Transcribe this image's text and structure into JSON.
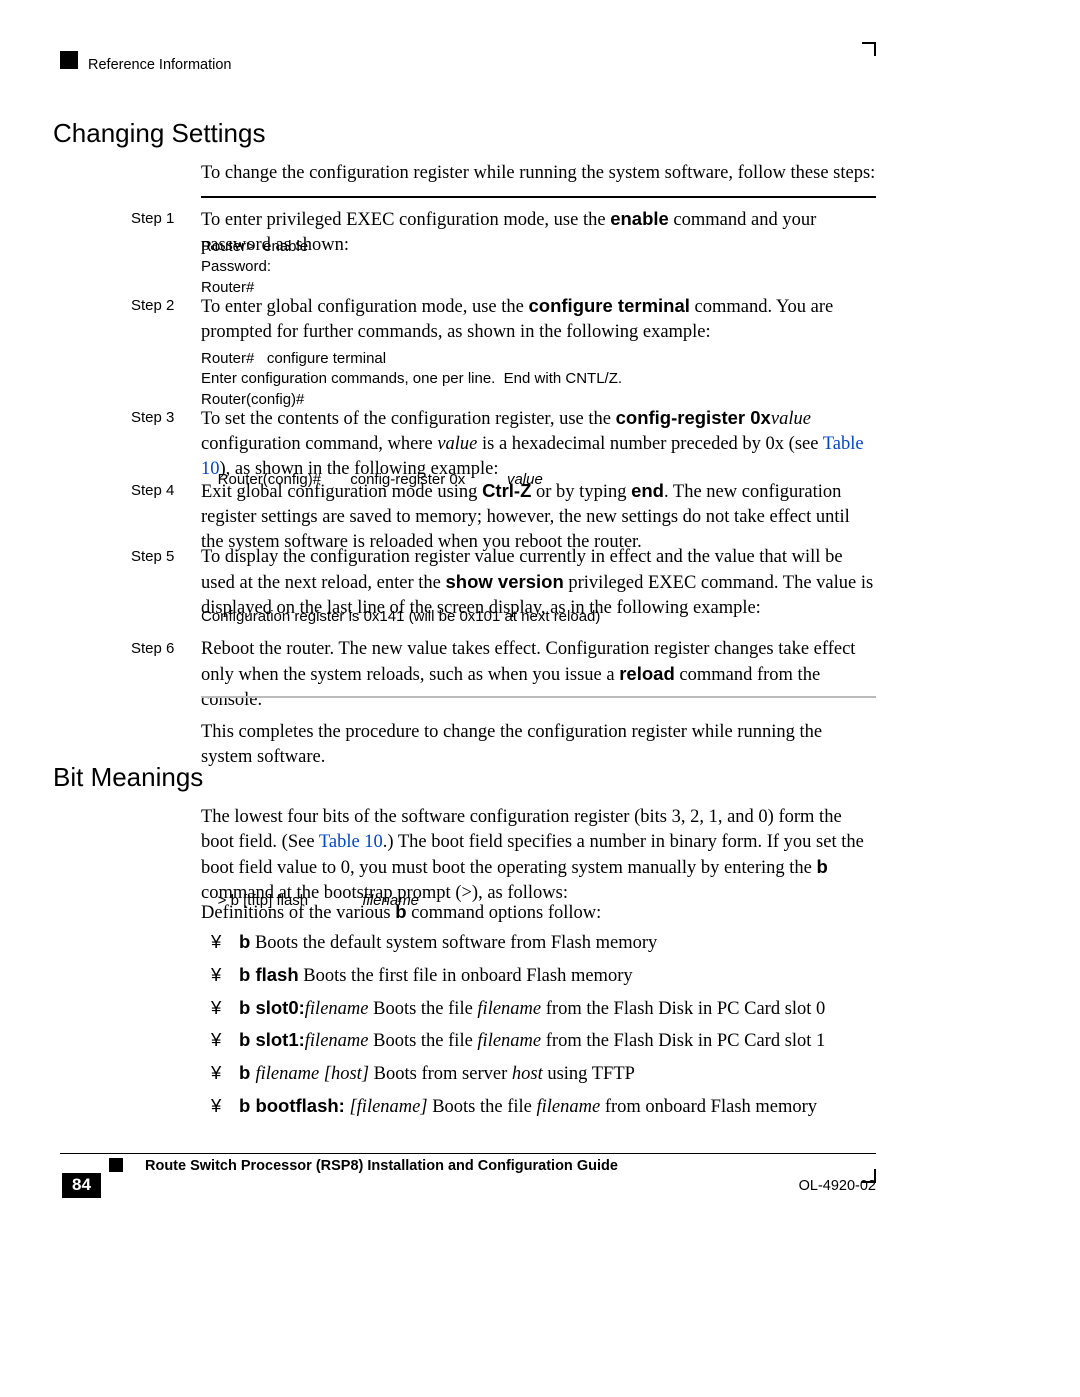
{
  "header": {
    "ref": "Reference Information"
  },
  "sections": {
    "changing_settings": {
      "title": "Changing Settings",
      "intro": "To change the configuration register while running the system software, follow these steps:",
      "outro": "This completes the procedure to change the configuration register while running the system software."
    },
    "bit_meanings": {
      "title": "Bit Meanings",
      "para1a": "The lowest four bits of the software configuration register (bits 3, 2, 1, and 0) form the boot field. (See",
      "para1_link": "Table 10",
      "para1b": ".) The boot field specifies a number in binary form. If you set the boot field value to 0, you must boot the operating system manually by entering the ",
      "b_cmd": "b",
      "para1c": " command at the bootstrap prompt (>), as follows:",
      "code_line_a": "> b [tftp] flash ",
      "code_line_b": "filename",
      "def_intro_a": "Definitions of the various ",
      "def_intro_b": "b",
      "def_intro_c": " command options follow:"
    }
  },
  "steps": {
    "s1": {
      "label": "Step 1",
      "text_a": "To enter privileged EXEC configuration mode, use the ",
      "cmd": "enable",
      "text_b": " command and your password as shown:",
      "code": "Router>  enable\nPassword:\nRouter#"
    },
    "s2": {
      "label": "Step 2",
      "text_a": "To enter global configuration mode, use the ",
      "cmd": "configure terminal",
      "text_b": " command. You are prompted for further commands, as shown in the following example:",
      "code": "Router#   configure terminal\nEnter configuration commands, one per line.  End with CNTL/Z.\nRouter(config)#"
    },
    "s3": {
      "label": "Step 3",
      "text_a": "To set the contents of the configuration register, use the ",
      "cmd": "config-register 0x",
      "val": "value",
      "text_b": " configuration command, where ",
      "val2": "value",
      "text_c": " is a hexadecimal number preceded by 0x (see ",
      "link": "Table 10",
      "text_d": "), as shown in the following example:",
      "code_a": "Router(config)#       config-register 0x",
      "code_b": "value"
    },
    "s4": {
      "label": "Step 4",
      "text_a": "Exit global configuration mode using ",
      "cmd1": "Ctrl-Z",
      "text_b": " or by typing ",
      "cmd2": "end",
      "text_c": ". The new configuration register settings are saved to memory; however, the new settings do not take effect until the system software is reloaded when you reboot the router."
    },
    "s5": {
      "label": "Step 5",
      "text_a": "To display the configuration register value currently in effect and the value that will be used at the next reload, enter the ",
      "cmd": "show version",
      "text_b": " privileged EXEC command. The value is displayed on the last line of the screen display, as in the following example:",
      "code": "Configuration register is 0x141 (will be 0x101 at next reload)"
    },
    "s6": {
      "label": "Step 6",
      "text_a": "Reboot the router. The new value takes effect. Configuration register changes take effect only when the system reloads, such as when you issue a ",
      "cmd": "reload",
      "text_b": " command from the console."
    }
  },
  "bullets": {
    "b1": {
      "cmd": "b",
      "text": " Boots the default system software from Flash memory"
    },
    "b2": {
      "cmd": "b flash",
      "text": " Boots the first file in onboard Flash memory"
    },
    "b3": {
      "cmd": "b slot0:",
      "fn": "filename",
      "mid": " Boots the file   ",
      "fn2": "filename",
      "text": " from the Flash Disk in PC Card slot 0"
    },
    "b4": {
      "cmd": "b slot1:",
      "fn": "filename",
      "mid": " Boots the file   ",
      "fn2": "filename",
      "text": " from the Flash Disk in PC Card slot 1"
    },
    "b5": {
      "cmd": "b ",
      "fn": "filename [host]",
      "text": "   Boots from server ",
      "host": "host",
      "text2": " using TFTP"
    },
    "b6": {
      "cmd": "b bootflash:",
      "fn": " [filename]",
      "text": "   Boots the file ",
      "fn2": "filename",
      "text2": " from onboard Flash memory"
    },
    "bullet": "¥"
  },
  "footer": {
    "title": "Route Switch Processor (RSP8) Installation and Configuration Guide",
    "page": "84",
    "docid": "OL-4920-02"
  }
}
